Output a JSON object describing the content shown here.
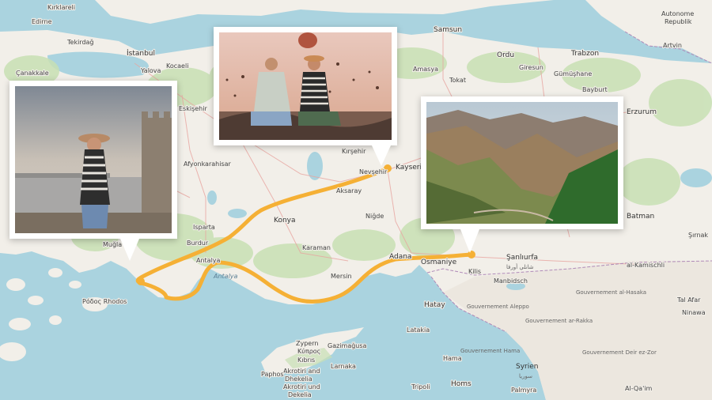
{
  "map": {
    "title": "",
    "route_color": "#f5b035",
    "land_color": "#f2efe9",
    "forest_color": "#c8e0b4",
    "water_color": "#aad3df",
    "route_stops": [
      {
        "name": "Muğla coast",
        "photo": "woman-castle-sea"
      },
      {
        "name": "Kayseri",
        "photo": "hot-air-balloons-cappadocia"
      },
      {
        "name": "Osmaniye",
        "photo": "mountain-valley"
      }
    ]
  },
  "labels": {
    "istanbul": "İstanbul",
    "kocaeli": "Kocaeli",
    "yalova": "Yalova",
    "edirne": "Edirne",
    "kirklareli": "Kırklareli",
    "tekirdag": "Tekirdağ",
    "canakkale": "Çanakkale",
    "eskisehir": "Eskişehir",
    "afyon": "Afyonkarahisar",
    "isparta": "Isparta",
    "burdur": "Burdur",
    "antalya": "Antalya",
    "antalya_gulf": "Antalya",
    "konya": "Konya",
    "karaman": "Karaman",
    "aksaray": "Aksaray",
    "nigde": "Niğde",
    "kirsehir": "Kırşehir",
    "nevsehir": "Nevşehir",
    "kayseri": "Kayseri",
    "adana": "Adana",
    "mersin": "Mersin",
    "osmaniye": "Osmaniye",
    "hatay": "Hatay",
    "sanliurfa": "Şanlıurfa",
    "batman": "Batman",
    "erzurum": "Erzurum",
    "ordu": "Ordu",
    "giresun": "Giresun",
    "trabzon": "Trabzon",
    "samsun": "Samsun",
    "amasya": "Amasya",
    "tokat": "Tokat",
    "gumushane": "Gümüşhane",
    "bayburt": "Bayburt",
    "artvin": "Artvin",
    "mugla": "Muğla",
    "rodos": "Ρόδος Rhodos",
    "kibris_gr": "Κύπρος",
    "kibris": "Kıbrıs",
    "zypern": "Zypern",
    "akrotiri": "Akrotiri and",
    "dhekelia": "Dhekelia",
    "akrotiri2": "Akrotiri und",
    "dekelia": "Dekelia",
    "gazimagusa": "Gazimağusa",
    "larnaka": "Larnaka",
    "paphos": "Paphos",
    "tripoli": "Tripoli",
    "homs": "Homs",
    "hama": "Hama",
    "latakia": "Latakia",
    "aleppo_gov": "Gouvernement Aleppo",
    "raqqa_gov": "Gouvernement ar-Rakka",
    "hasaka_gov": "Gouvernement al-Hasaka",
    "deir_gov": "Gouvernement Deir ez-Zor",
    "hama_gov": "Gouvernement Hama",
    "syria": "Syrien",
    "palmyra": "Palmyra",
    "manbidj": "Manbidsch",
    "kilis": "Kilis",
    "al_qamischli": "al-Kamischli",
    "tal_afar": "Tal Afar",
    "ninawa": "Ninawa",
    "al_qaim": "Al-Qa'im",
    "sirnak": "Şırnak",
    "sanliurfa_ar": "شانلي أورفا",
    "syria_ar": "سوريا",
    "autonome": "Autonome",
    "republik": "Republik"
  }
}
